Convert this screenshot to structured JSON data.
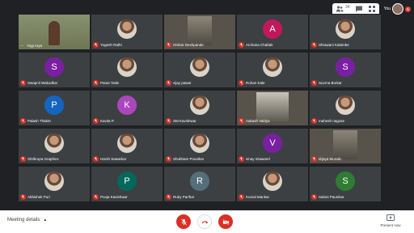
{
  "topbar": {
    "participant_count": "34",
    "you_label": "You",
    "notification_count": "5"
  },
  "participants": [
    {
      "name": "Yogi Arya",
      "kind": "speaker",
      "more": "..."
    },
    {
      "name": "Yogesh Rathi",
      "kind": "photo"
    },
    {
      "name": "Omkar Deshpande",
      "kind": "video"
    },
    {
      "name": "Archana Chafale",
      "kind": "letter",
      "letter": "A",
      "color": "#c2185b"
    },
    {
      "name": "Shrawani Kalambe",
      "kind": "photo"
    },
    {
      "name": "Swapnil Wakodkar",
      "kind": "letter",
      "letter": "S",
      "color": "#7b1fa2"
    },
    {
      "name": "Paras Yede",
      "kind": "photo"
    },
    {
      "name": "vijay pawar",
      "kind": "photo"
    },
    {
      "name": "Rohan Kale",
      "kind": "photo"
    },
    {
      "name": "Suvrna Borkar",
      "kind": "letter",
      "letter": "S",
      "color": "#7b1fa2"
    },
    {
      "name": "Palash Thakre",
      "kind": "letter",
      "letter": "P",
      "color": "#1565c0"
    },
    {
      "name": "Kavita P.",
      "kind": "letter",
      "letter": "K",
      "color": "#ab47bc"
    },
    {
      "name": "SM Kavishwar",
      "kind": "photo"
    },
    {
      "name": "Aakash Vaidya",
      "kind": "video-wide"
    },
    {
      "name": "mahesh nagose",
      "kind": "photo"
    },
    {
      "name": "Shrikrupa Graphics",
      "kind": "photo"
    },
    {
      "name": "Harsh Sawarkar",
      "kind": "photo"
    },
    {
      "name": "Shubham Pounikar",
      "kind": "photo"
    },
    {
      "name": "vinay nitawarel",
      "kind": "letter",
      "letter": "V",
      "color": "#7b1fa2"
    },
    {
      "name": "drjaya Muradc",
      "kind": "video"
    },
    {
      "name": "Abhishek Puri",
      "kind": "photo"
    },
    {
      "name": "Pooja Kavishwar",
      "kind": "letter",
      "letter": "P",
      "color": "#00695c"
    },
    {
      "name": "Ruby Parihar",
      "kind": "letter",
      "letter": "R",
      "color": "#546e7a"
    },
    {
      "name": "Komal Mankar",
      "kind": "photo"
    },
    {
      "name": "Saloni Paunikar",
      "kind": "letter",
      "letter": "S",
      "color": "#2e7d32"
    }
  ],
  "bottombar": {
    "meeting_details": "Meeting details",
    "present_now": "Present now"
  }
}
